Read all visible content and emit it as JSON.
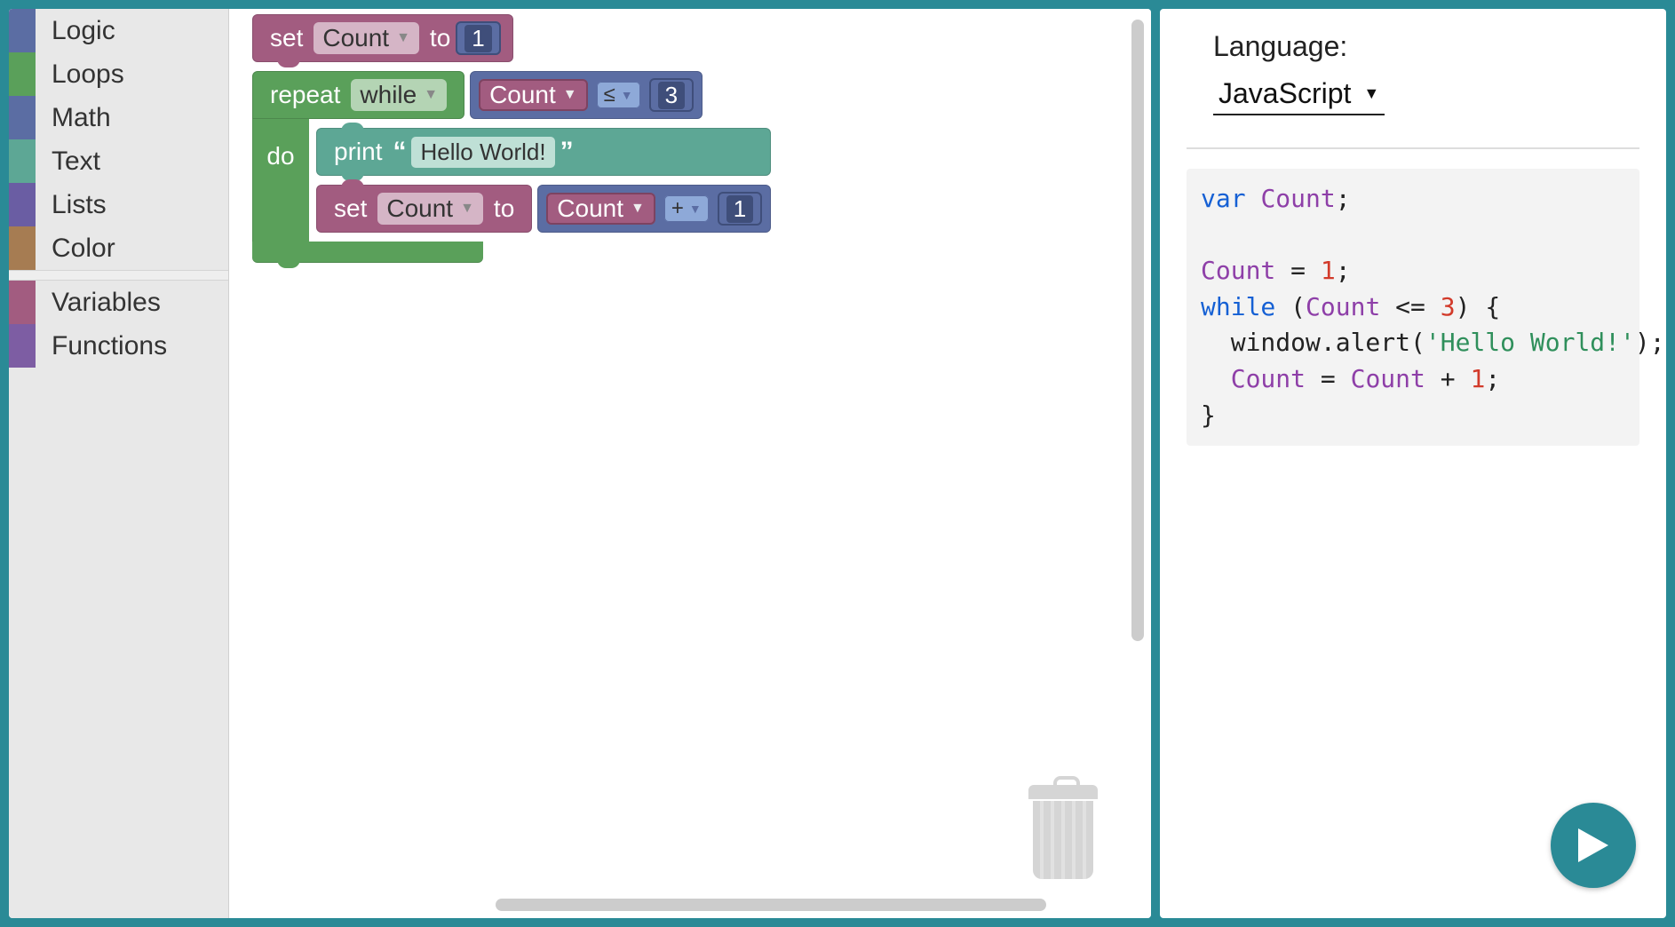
{
  "sidebar": {
    "categories": [
      {
        "label": "Logic",
        "color": "#5b6da3"
      },
      {
        "label": "Loops",
        "color": "#5aa05a"
      },
      {
        "label": "Math",
        "color": "#5b6da3"
      },
      {
        "label": "Text",
        "color": "#5da795"
      },
      {
        "label": "Lists",
        "color": "#6a5da3"
      },
      {
        "label": "Color",
        "color": "#a67c52"
      }
    ],
    "categories2": [
      {
        "label": "Variables",
        "color": "#a25c80"
      },
      {
        "label": "Functions",
        "color": "#7d5da3"
      }
    ]
  },
  "blocks": {
    "set1": {
      "set": "set",
      "var": "Count",
      "to": "to",
      "value": "1"
    },
    "repeat": {
      "repeat": "repeat",
      "mode": "while",
      "cond_var": "Count",
      "cond_op": "≤",
      "cond_val": "3",
      "do": "do"
    },
    "print": {
      "label": "print",
      "text": "Hello World!"
    },
    "set2": {
      "set": "set",
      "var": "Count",
      "to": "to",
      "expr_var": "Count",
      "expr_op": "+",
      "expr_val": "1"
    }
  },
  "right": {
    "lang_label": "Language:",
    "lang_value": "JavaScript"
  },
  "code": {
    "kw_var": "var",
    "ident": "Count",
    "assign_val": "1",
    "kw_while": "while",
    "cmp": "<=",
    "cmp_val": "3",
    "alert_call": "window.alert",
    "alert_arg": "'Hello World!'",
    "plus_val": "1"
  }
}
